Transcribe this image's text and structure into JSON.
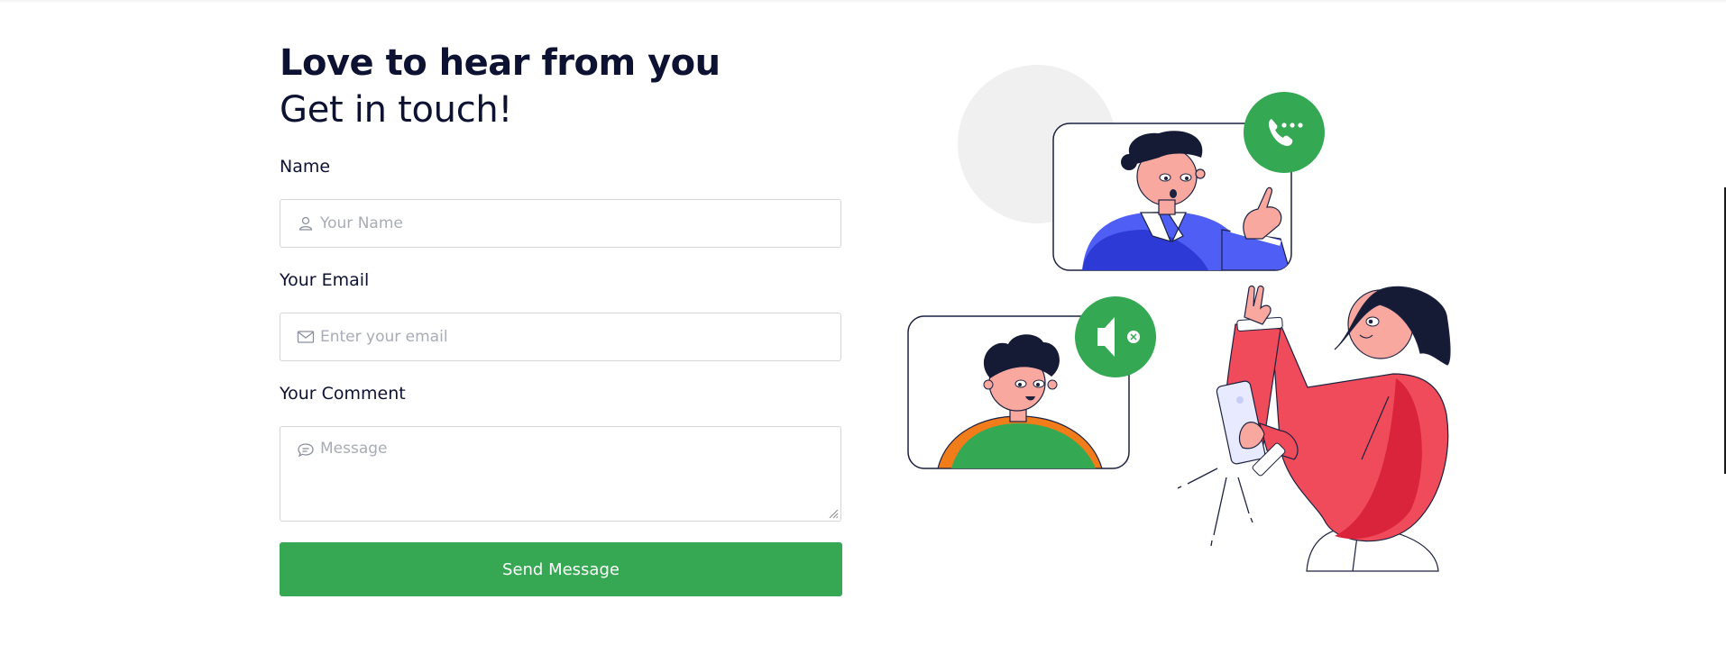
{
  "contact": {
    "heading": "Love to hear from you",
    "subheading": "Get in touch!",
    "name": {
      "label": "Name",
      "placeholder": "Your Name",
      "value": ""
    },
    "email": {
      "label": "Your Email",
      "placeholder": "Enter your email",
      "value": ""
    },
    "comment": {
      "label": "Your Comment",
      "placeholder": "Message",
      "value": ""
    },
    "submit_label": "Send Message"
  },
  "theme": {
    "accent": "#36a853",
    "heading_color": "#0d1233",
    "border": "#d5d5d5",
    "illustration_blue": "#4f5ff5",
    "illustration_red": "#f04b5a",
    "illustration_green": "#34a853"
  },
  "icons": [
    "user-icon",
    "mail-icon",
    "chat-bubble-icon",
    "phone-call-icon",
    "speaker-mute-icon"
  ]
}
